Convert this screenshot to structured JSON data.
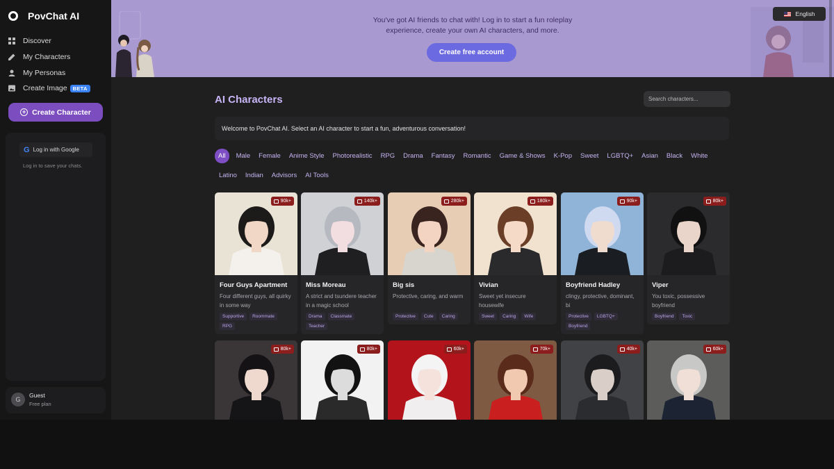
{
  "app": {
    "name": "PovChat AI",
    "logo_icon": "ring-logo-icon"
  },
  "sidebar": {
    "items": [
      {
        "label": "Discover",
        "icon": "grid-icon"
      },
      {
        "label": "My Characters",
        "icon": "pencil-icon"
      },
      {
        "label": "My Personas",
        "icon": "person-icon"
      },
      {
        "label": "Create Image",
        "icon": "image-icon",
        "badge": "BETA"
      }
    ],
    "create_button": "Create Character",
    "login_button": "Log in with Google",
    "login_hint": "Log in to save your chats.",
    "user": {
      "initial": "G",
      "name": "Guest",
      "plan": "Free plan"
    }
  },
  "banner": {
    "text": "You've got AI friends to chat with! Log in to start a fun roleplay experience, create your own AI characters, and more.",
    "cta": "Create free account",
    "language": "English"
  },
  "main": {
    "title": "AI Characters",
    "search_placeholder": "Search characters...",
    "welcome": "Welcome to PovChat AI. Select an AI character to start a fun, adventurous conversation!",
    "tags_row1": [
      "All",
      "Male",
      "Female",
      "Anime Style",
      "Photorealistic",
      "RPG",
      "Drama",
      "Fantasy",
      "Romantic",
      "Game & Shows",
      "K-Pop",
      "Sweet",
      "LGBTQ+",
      "Asian",
      "Black",
      "White"
    ],
    "tags_row2": [
      "Latino",
      "Indian",
      "Advisors",
      "AI Tools"
    ],
    "active_tag": "All"
  },
  "cards": [
    {
      "name": "Four Guys Apartment",
      "desc": "Four different guys, all quirky in some way",
      "count": "90k+",
      "tags": [
        "Supportive",
        "Roommate",
        "RPG"
      ]
    },
    {
      "name": "Miss Moreau",
      "desc": "A strict and tsundere teacher in a magic school",
      "count": "140k+",
      "tags": [
        "Drama",
        "Classmate",
        "Teacher"
      ]
    },
    {
      "name": "Big sis",
      "desc": "Protective, caring, and warm",
      "count": "280k+",
      "tags": [
        "Protective",
        "Cute",
        "Caring"
      ]
    },
    {
      "name": "Vivian",
      "desc": "Sweet yet insecure housewife",
      "count": "180k+",
      "tags": [
        "Sweet",
        "Caring",
        "Wife"
      ]
    },
    {
      "name": "Boyfriend Hadley",
      "desc": "clingy, protective, dominant, bi",
      "count": "90k+",
      "tags": [
        "Protective",
        "LGBTQ+",
        "Boyfriend"
      ]
    },
    {
      "name": "Viper",
      "desc": "You toxic, possessive boyfriend",
      "count": "80k+",
      "tags": [
        "Boyfriend",
        "Toxic"
      ]
    },
    {
      "count": "80k+"
    },
    {
      "count": "80k+"
    },
    {
      "count": "60k+"
    },
    {
      "count": "70k+"
    },
    {
      "count": "40k+"
    },
    {
      "count": "60k+"
    }
  ],
  "colors": {
    "accent": "#7d4ec4",
    "banner": "#a89ad0",
    "badge": "#8c1d1d",
    "title": "#c7b4f5"
  }
}
